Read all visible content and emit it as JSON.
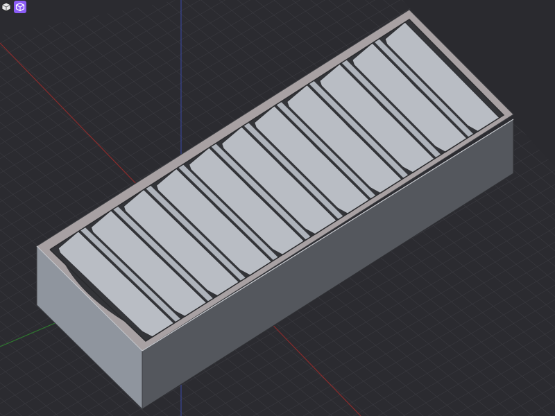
{
  "app": {
    "name": ""
  },
  "toolbar": {
    "buttons": [
      {
        "icon": "view-cube-icon",
        "active": false
      },
      {
        "icon": "box-icon",
        "active": true
      }
    ]
  },
  "viewport": {
    "background": "#2b2b30",
    "grid_color": "#3c3c42",
    "axis_colors": {
      "x": "#8a2b2b",
      "y": "#2f7a2f",
      "z": "#3b4aa8"
    }
  },
  "model": {
    "object": "sorting-tray",
    "compartments": 11,
    "colors": {
      "face_top": "#b9bdc4",
      "face_left": "#8f959e",
      "face_front": "#54575d",
      "rim_top": "#a8a1a3",
      "slot_interior": "#333438",
      "divider": "#aeb3bb"
    }
  },
  "accent": "#8b5cf6"
}
